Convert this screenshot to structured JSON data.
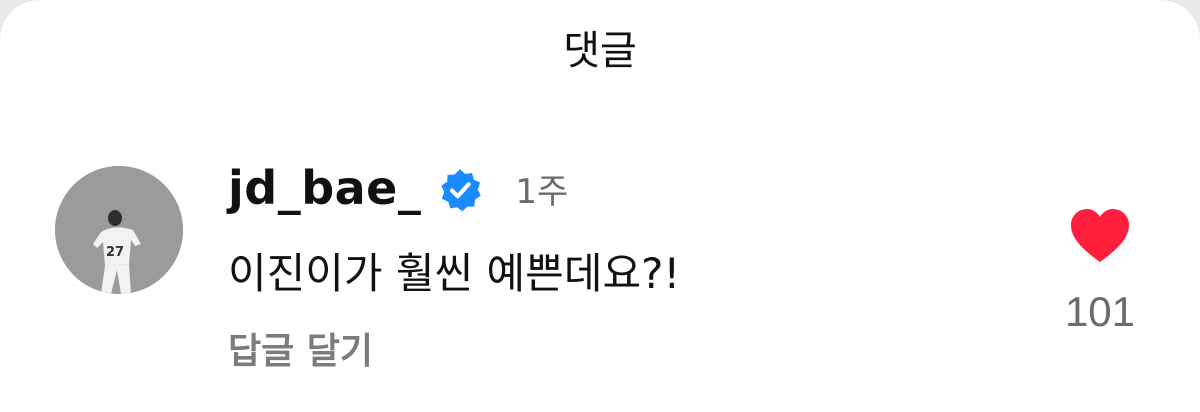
{
  "sheet": {
    "title": "댓글"
  },
  "comment": {
    "username": "jd_bae_",
    "verified": true,
    "time": "1주",
    "text": "이진이가 훨씬 예쁜데요?!",
    "reply_label": "답글 달기",
    "avatar_jersey_number": "27",
    "likes": {
      "count": "101",
      "icon": "heart-icon",
      "color": "#ff1f3d"
    }
  },
  "colors": {
    "verified_badge": "#1a8cff",
    "avatar_bg": "#9b9b9d"
  }
}
